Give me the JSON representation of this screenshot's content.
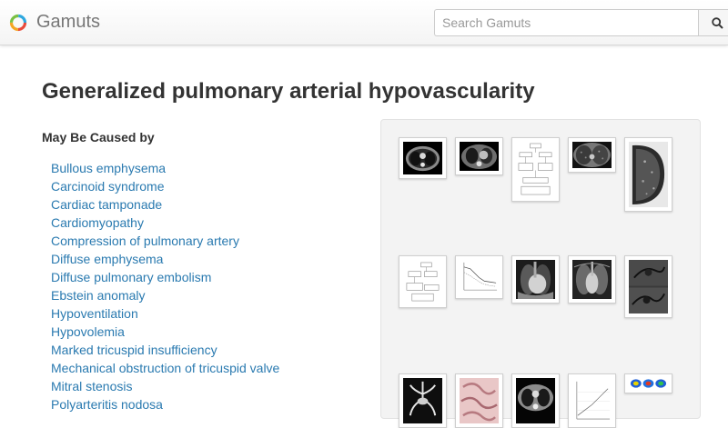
{
  "header": {
    "brand": "Gamuts",
    "logo_icon": "ring-logo-icon",
    "search_placeholder": "Search Gamuts",
    "search_icon": "search-icon"
  },
  "page": {
    "title": "Generalized pulmonary arterial hypovascularity"
  },
  "causes": {
    "heading": "May Be Caused by",
    "items": [
      "Bullous emphysema",
      "Carcinoid syndrome",
      "Cardiac tamponade",
      "Cardiomyopathy",
      "Compression of pulmonary artery",
      "Diffuse emphysema",
      "Diffuse pulmonary embolism",
      "Ebstein anomaly",
      "Hypoventilation",
      "Hypovolemia",
      "Marked tricuspid insufficiency",
      "Mechanical obstruction of tricuspid valve",
      "Mitral stenosis",
      "Polyarteritis nodosa"
    ]
  },
  "gallery": {
    "images": [
      "ct-chest-thumbnail",
      "ct-chest-thumbnail",
      "flowchart-thumbnail",
      "ct-lungs-thumbnail",
      "ct-lung-thumbnail",
      "flowchart-thumbnail",
      "graph-thumbnail",
      "chest-radiograph-thumbnail",
      "chest-radiograph-thumbnail",
      "angiography-thumbnail",
      "angiography-thumbnail",
      "pathology-thumbnail",
      "ct-chest-thumbnail",
      "graph-thumbnail",
      "perfusion-scan-thumbnail"
    ]
  }
}
